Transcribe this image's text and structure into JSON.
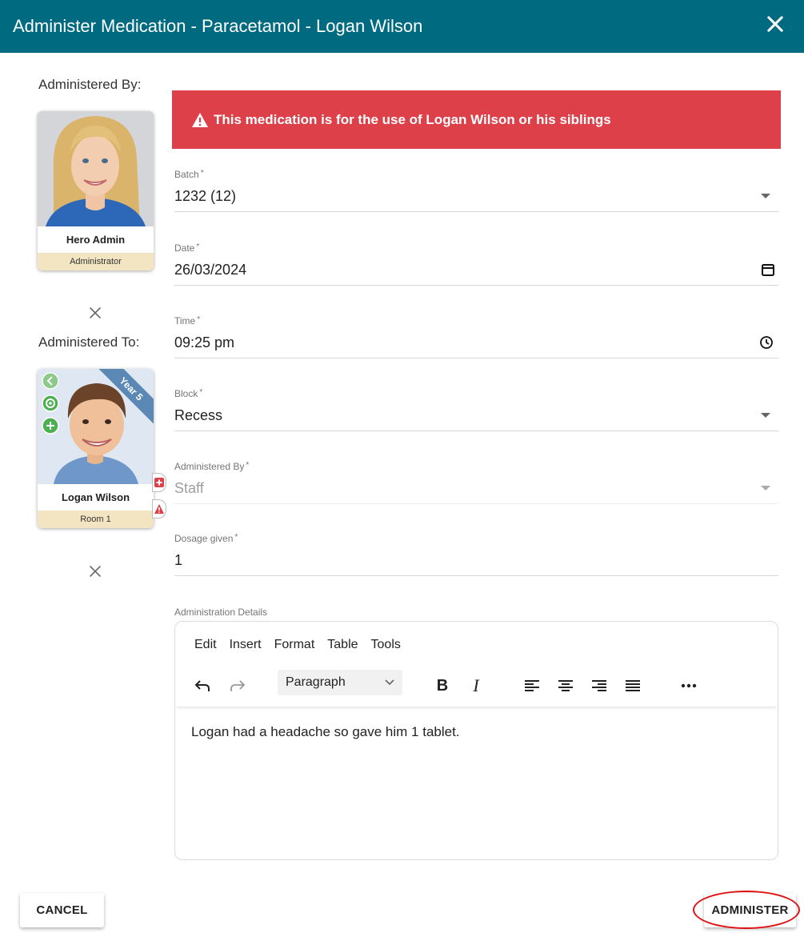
{
  "dialog": {
    "title": "Administer Medication - Paracetamol - Logan Wilson"
  },
  "administered_by": {
    "label": "Administered By:",
    "name": "Hero Admin",
    "role": "Administrator"
  },
  "administered_to": {
    "label": "Administered To:",
    "name": "Logan Wilson",
    "room": "Room 1",
    "year_ribbon": "Year 5"
  },
  "alert": {
    "text": "This medication is for the use of Logan Wilson or his siblings"
  },
  "form": {
    "batch": {
      "label": "Batch",
      "required": "*",
      "value": "1232 (12)"
    },
    "date": {
      "label": "Date",
      "required": "*",
      "value": "26/03/2024"
    },
    "time": {
      "label": "Time",
      "required": "*",
      "value": "09:25 pm"
    },
    "block": {
      "label": "Block",
      "required": "*",
      "value": "Recess"
    },
    "administered_by": {
      "label": "Administered By",
      "required": "*",
      "value": "Staff"
    },
    "dosage": {
      "label": "Dosage given",
      "required": "*",
      "value": "1"
    }
  },
  "editor": {
    "label": "Administration Details",
    "menu": [
      "Edit",
      "Insert",
      "Format",
      "Table",
      "Tools"
    ],
    "paragraph_select": "Paragraph",
    "body": "Logan had a headache so gave him 1 tablet."
  },
  "buttons": {
    "cancel": "CANCEL",
    "administer": "ADMINISTER"
  },
  "colors": {
    "header": "#006a80",
    "alert": "#de404a",
    "role_band": "#f4e5c2",
    "ribbon": "#5b88b5",
    "highlight": "#e01010"
  }
}
